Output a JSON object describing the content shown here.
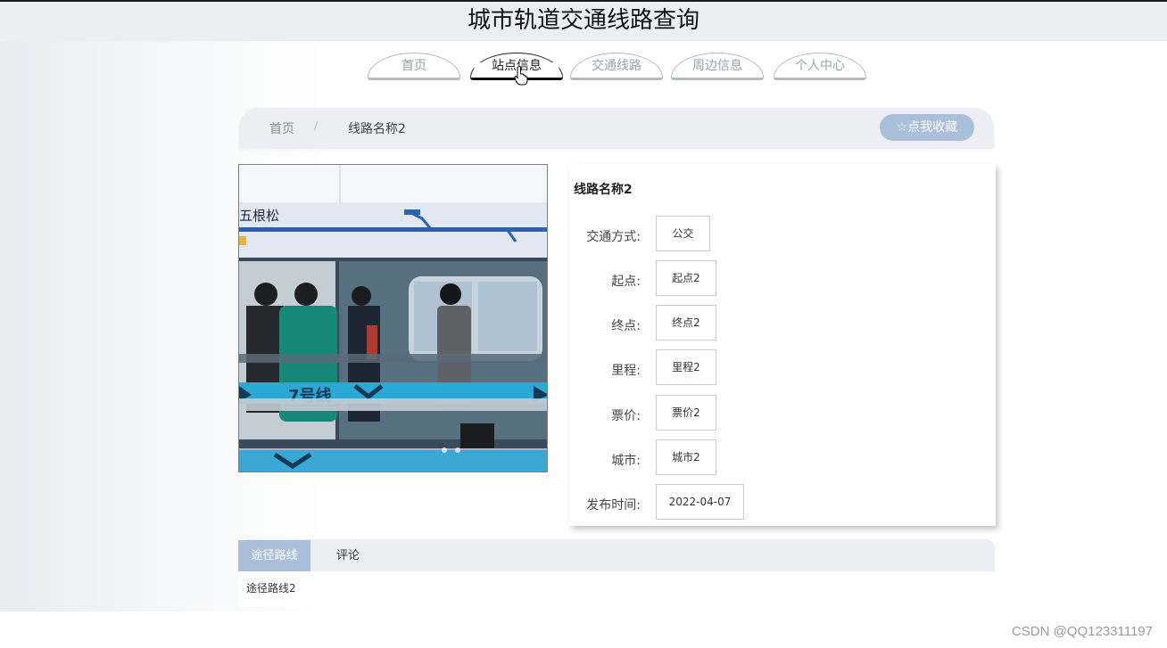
{
  "header": {
    "title": "城市轨道交通线路查询"
  },
  "nav": {
    "tabs": [
      {
        "label": "首页",
        "active": false
      },
      {
        "label": "站点信息",
        "active": true
      },
      {
        "label": "交通线路",
        "active": false
      },
      {
        "label": "周边信息",
        "active": false
      },
      {
        "label": "个人中心",
        "active": false
      }
    ]
  },
  "breadcrumb": {
    "home": "首页",
    "separator": "/",
    "current": "线路名称2"
  },
  "favorite_button": {
    "icon": "star-icon",
    "label": "☆点我收藏"
  },
  "photo": {
    "station_sign": "五根松",
    "line_sign": "7号线"
  },
  "detail": {
    "title": "线路名称2",
    "fields": [
      {
        "label": "交通方式:",
        "value": "公交"
      },
      {
        "label": "起点:",
        "value": "起点2"
      },
      {
        "label": "终点:",
        "value": "终点2"
      },
      {
        "label": "里程:",
        "value": "里程2"
      },
      {
        "label": "票价:",
        "value": "票价2"
      },
      {
        "label": "城市:",
        "value": "城市2"
      },
      {
        "label": "发布时间:",
        "value": "2022-04-07"
      }
    ]
  },
  "tabs": {
    "route_label": "途径路线",
    "comment_label": "评论",
    "route_content": "途径路线2"
  },
  "watermark": "CSDN @QQ123311197",
  "colors": {
    "accent": "#aac0da",
    "header_bg": "#eceef1"
  }
}
